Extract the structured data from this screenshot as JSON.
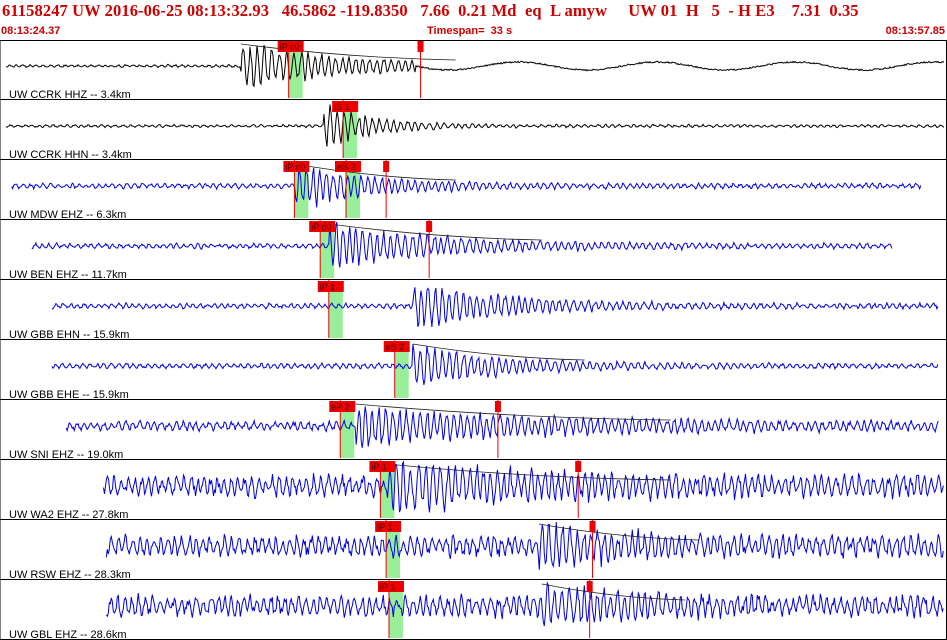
{
  "header": {
    "title": "61158247 UW 2016-06-25 08:13:32.93   46.5862 -119.8350   7.66  0.21 Md  eq  L amyw     UW 01  H   5  - H E3    7.31  0.35",
    "start_time": "08:13:24.37",
    "timespan_text": "Timespan=  33 s",
    "end_time": "08:13:57.85"
  },
  "colors": {
    "header_text": "#cc0000",
    "trace_horizontal": "#000000",
    "trace_vertical_short": "#0000dd",
    "pick_flag": "#ee0000",
    "pick_window": "#99ee99",
    "coda_curve": "#222222"
  },
  "chart_data": {
    "type": "line",
    "title": "",
    "xlabel": "",
    "ylabel": "",
    "x_range_s": [
      0,
      33
    ],
    "start_time": "08:13:24.37",
    "end_time": "08:13:57.85",
    "timespan_s": 33,
    "grid": false,
    "legend": "none",
    "series": [
      {
        "label": "UW CCRK HHZ -- 3.4km",
        "color": "#000000",
        "trace_start_s": 0.0,
        "trace_end_s": 33.0,
        "onset_s": 8.4,
        "signal_end_s": 14.5,
        "picks": [
          {
            "label": "iP c0",
            "time_s": 10.0
          },
          {
            "label": "",
            "time_s": 14.6
          }
        ]
      },
      {
        "label": "UW CCRK HHN -- 3.4km",
        "color": "#000000",
        "trace_start_s": 0.0,
        "trace_end_s": 33.0,
        "onset_s": 11.3,
        "signal_end_s": 14.0,
        "picks": [
          {
            "label": "iS 1",
            "time_s": 11.9
          }
        ]
      },
      {
        "label": "UW MDW EHZ -- 6.3km",
        "color": "#0000dd",
        "trace_start_s": 0.2,
        "trace_end_s": 32.2,
        "onset_s": 10.3,
        "signal_end_s": 14.5,
        "picks": [
          {
            "label": "iP c0",
            "time_s": 10.2
          },
          {
            "label": "eS 2",
            "time_s": 12.0
          },
          {
            "label": "",
            "time_s": 13.4
          }
        ]
      },
      {
        "label": "UW BEN EHZ -- 11.7km",
        "color": "#0000dd",
        "trace_start_s": 0.9,
        "trace_end_s": 31.2,
        "onset_s": 11.5,
        "signal_end_s": 17.5,
        "picks": [
          {
            "label": "iP d0",
            "time_s": 11.1
          },
          {
            "label": "",
            "time_s": 14.9
          }
        ]
      },
      {
        "label": "UW GBB EHN -- 15.9km",
        "color": "#0000dd",
        "trace_start_s": 1.6,
        "trace_end_s": 32.8,
        "onset_s": 14.4,
        "signal_end_s": 19.5,
        "picks": [
          {
            "label": "iP 1",
            "time_s": 11.4
          }
        ]
      },
      {
        "label": "UW GBB EHE -- 15.9km",
        "color": "#0000dd",
        "trace_start_s": 1.6,
        "trace_end_s": 32.8,
        "onset_s": 14.4,
        "signal_end_s": 19.0,
        "picks": [
          {
            "label": "eS 2",
            "time_s": 13.7
          }
        ]
      },
      {
        "label": "UW SNI EHZ -- 19.0km",
        "color": "#0000dd",
        "trace_start_s": 2.1,
        "trace_end_s": 32.8,
        "onset_s": 12.4,
        "signal_end_s": 22.0,
        "picks": [
          {
            "label": "eP 2",
            "time_s": 11.8
          },
          {
            "label": "",
            "time_s": 17.3
          }
        ]
      },
      {
        "label": "UW WA2 EHZ -- 27.8km",
        "color": "#0000dd",
        "trace_start_s": 3.4,
        "trace_end_s": 33.0,
        "onset_s": 13.5,
        "signal_end_s": 22.0,
        "picks": [
          {
            "label": "iP 1",
            "time_s": 13.2
          },
          {
            "label": "",
            "time_s": 20.1
          }
        ]
      },
      {
        "label": "UW RSW EHZ -- 28.3km",
        "color": "#0000dd",
        "trace_start_s": 3.5,
        "trace_end_s": 33.0,
        "onset_s": 18.8,
        "signal_end_s": 23.0,
        "picks": [
          {
            "label": "iP 1",
            "time_s": 13.4
          },
          {
            "label": "",
            "time_s": 20.6
          }
        ]
      },
      {
        "label": "UW GBL EHZ -- 28.6km",
        "color": "#0000dd",
        "trace_start_s": 3.5,
        "trace_end_s": 33.0,
        "onset_s": 18.9,
        "signal_end_s": 22.5,
        "picks": [
          {
            "label": "iP 1",
            "time_s": 13.5
          },
          {
            "label": "",
            "time_s": 20.5
          }
        ]
      }
    ]
  }
}
